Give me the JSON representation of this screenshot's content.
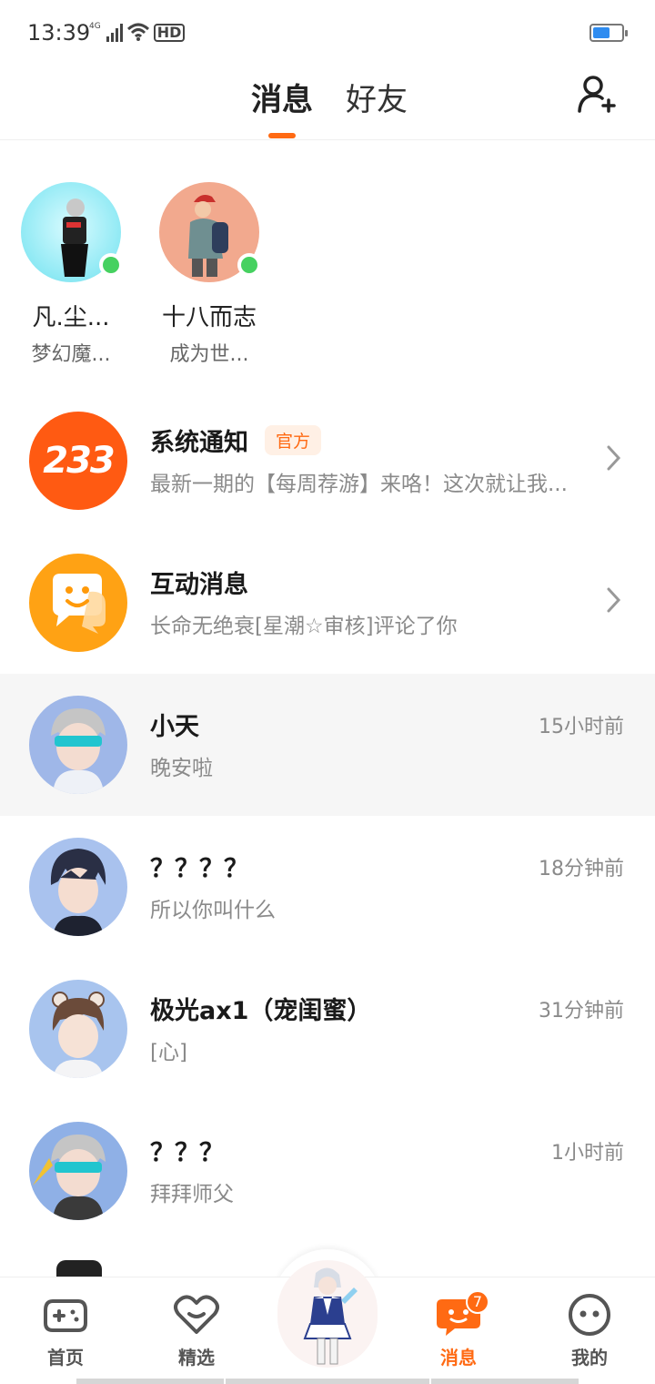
{
  "status_bar": {
    "time": "13:39",
    "network": "4G",
    "hd": "HD"
  },
  "header": {
    "tabs": [
      {
        "label": "消息",
        "active": true
      },
      {
        "label": "好友",
        "active": false
      }
    ],
    "add_friend_icon": "add-user-icon"
  },
  "online_friends": [
    {
      "name": "凡.尘...",
      "status": "梦幻魔..."
    },
    {
      "name": "十八而志",
      "status": "成为世..."
    }
  ],
  "system_rows": [
    {
      "title": "系统通知",
      "badge": "官方",
      "subtitle": "最新一期的【每周荐游】来咯！这次就让我...",
      "avatar_text": "233"
    },
    {
      "title": "互动消息",
      "subtitle": "长命无绝衰[星潮☆审核]评论了你"
    }
  ],
  "chats": [
    {
      "name": "小天",
      "message": "晚安啦",
      "time": "15小时前"
    },
    {
      "name": "？？？？",
      "message": "所以你叫什么",
      "time": "18分钟前"
    },
    {
      "name": "极光ax1（宠闺蜜）",
      "message": "[心]",
      "time": "31分钟前"
    },
    {
      "name": "？？？",
      "message": "拜拜师父",
      "time": "1小时前"
    }
  ],
  "bottom_nav": [
    {
      "label": "首页",
      "icon": "gamepad-icon"
    },
    {
      "label": "精选",
      "icon": "heart-icon"
    },
    {
      "label": "消息",
      "icon": "message-icon",
      "badge": "7",
      "active": true
    },
    {
      "label": "我的",
      "icon": "face-icon"
    }
  ],
  "colors": {
    "accent": "#ff6a13",
    "online": "#46d160",
    "interaction": "#ffa214"
  }
}
